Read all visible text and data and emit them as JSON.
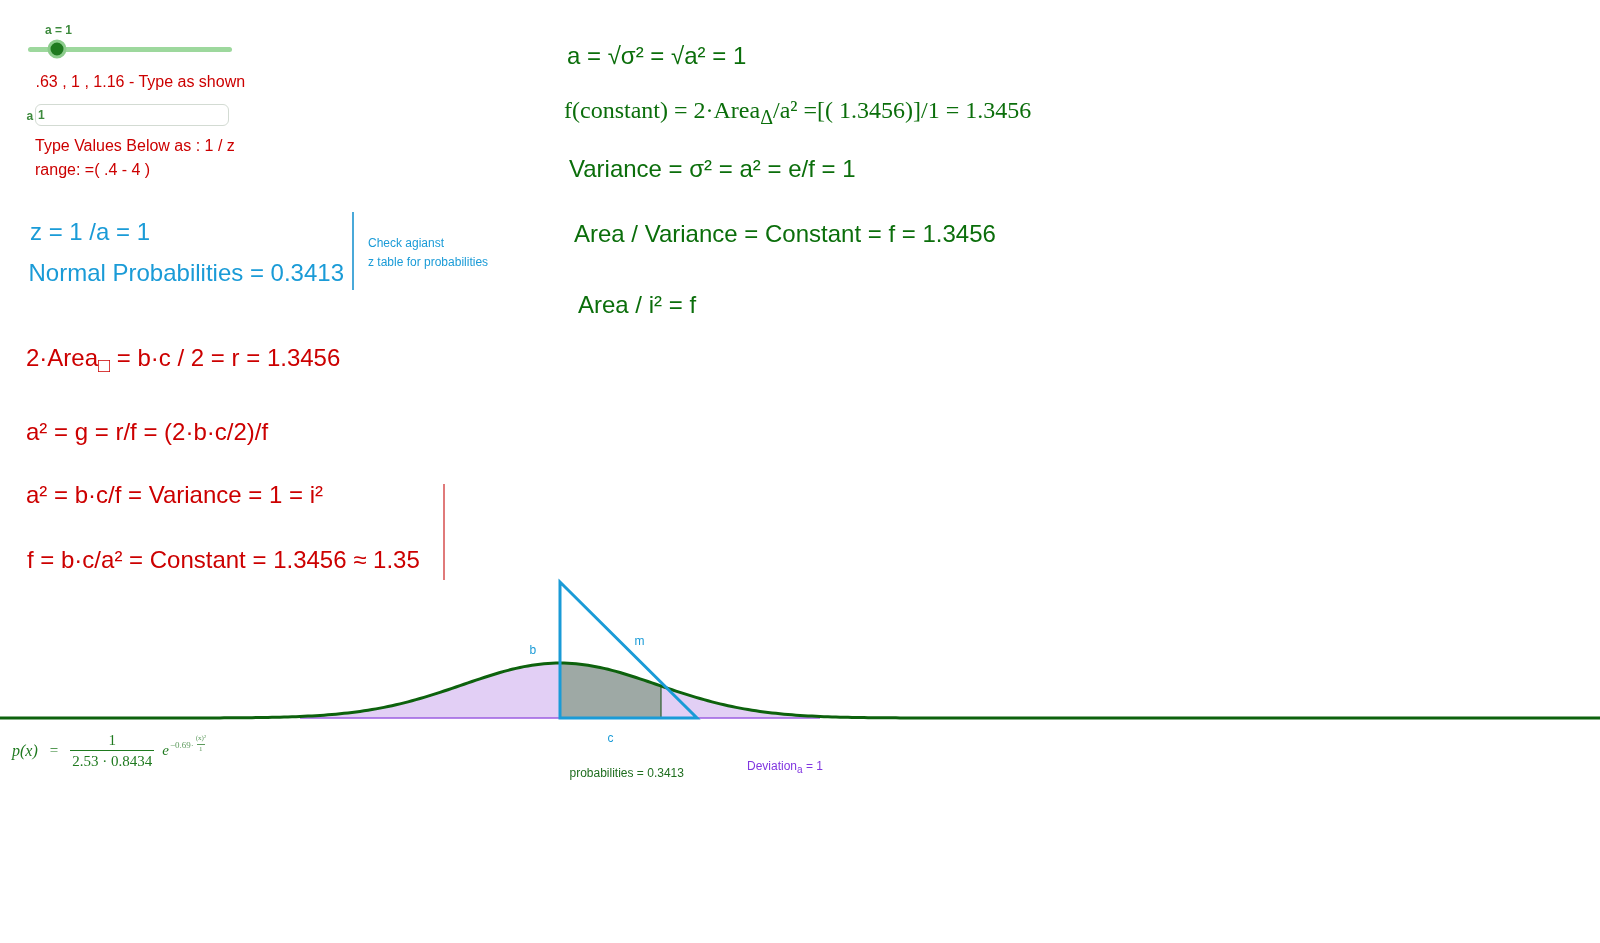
{
  "slider": {
    "caption": "a = 1",
    "level": 0.14
  },
  "hint": ".63 , 1 , 1.16 - Type as shown",
  "input": {
    "label": "a",
    "value": "1"
  },
  "instructions": [
    "Type Values Below as : 1 / z",
    "range: =( .4 - 4 )"
  ],
  "z_results": [
    "z = 1 /a = 1",
    "Normal Probabilities = 0.3413"
  ],
  "z_note": [
    "Check agianst",
    "z table for probabilities"
  ],
  "left_equations": [
    "2·Area$_{□}$ = b·c / 2 = r = 1.3456",
    "a² = g = r/f = (2·b·c/2)/f",
    "a² = b·c/f = Variance = 1 = i²",
    "f = b·c/a² = Constant = 1.3456 ≈ 1.35"
  ],
  "right_equations": [
    {
      "kind": "text",
      "text": "a = √σ² = √a² = 1"
    },
    {
      "kind": "formula",
      "text": "f(constant) = 2·Area$_{Δ}$/a² =[( 1.3456)]/1 = 1.3456"
    },
    {
      "kind": "text",
      "text": "Variance = σ² = a² = e/f = 1"
    },
    {
      "kind": "text",
      "text": "Area / Variance = Constant = f = 1.3456"
    },
    {
      "kind": "text",
      "text": "Area / i² = f"
    }
  ],
  "graph": {
    "segment_labels": [
      "b",
      "m",
      "c"
    ],
    "probabilities": "probabilities = 0.3413",
    "deviation": "Deviation$_{a}$ = 1"
  },
  "density_formula": {
    "lhs": "p(x)",
    "relation": "=",
    "numerator": "1",
    "denominator": "2.53 · 0.8434",
    "base": "e",
    "exponent": "−0.69·",
    "exponent_numerator": "(x)²",
    "exponent_denominator": "1"
  }
}
